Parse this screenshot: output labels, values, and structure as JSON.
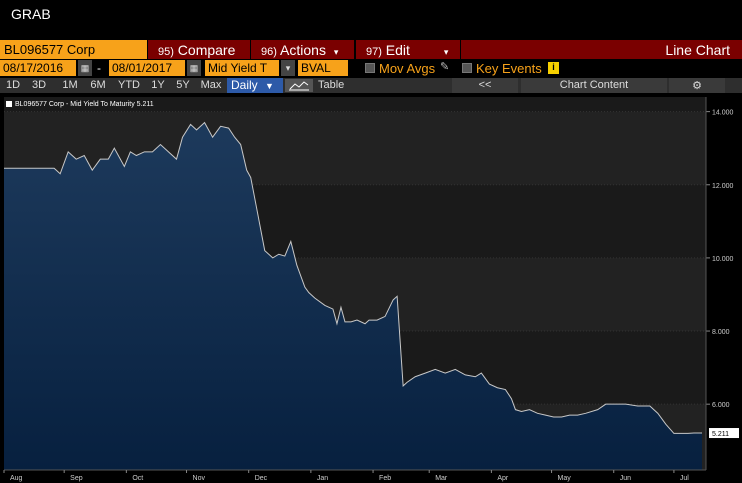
{
  "window": {
    "title": "GRAB"
  },
  "toolbar": {
    "security": "BL096577 Corp",
    "compare": {
      "num": "95)",
      "label": "Compare"
    },
    "actions": {
      "num": "96)",
      "label": "Actions"
    },
    "edit": {
      "num": "97)",
      "label": "Edit"
    },
    "chart_type": "Line Chart"
  },
  "settings": {
    "start_date": "08/17/2016",
    "end_date": "08/01/2017",
    "field": "Mid Yield T",
    "source": "BVAL",
    "mov_avgs": "Mov Avgs",
    "key_events": "Key Events",
    "info": "i"
  },
  "periods": [
    "1D",
    "3D",
    "1M",
    "6M",
    "YTD",
    "1Y",
    "5Y",
    "Max"
  ],
  "frequency": "Daily",
  "table_label": "Table",
  "collapse_label": "<<",
  "chart_content_label": "Chart Content",
  "gear": "⚙",
  "colors": {
    "accent": "#f7a21a",
    "toolbar_red": "#7a0000",
    "fill": "#0b2340",
    "line": "#c8c8c8"
  },
  "chart_data": {
    "type": "area",
    "legend": "BL096577 Corp - Mid Yield To Maturity 5.211",
    "last_value_label": "5.211",
    "ylim": [
      4.2,
      14.4
    ],
    "yticks": [
      "14.000",
      "12.000",
      "10.000",
      "8.000",
      "6.000"
    ],
    "ytick_values": [
      14,
      12,
      10,
      8,
      6
    ],
    "xticks": [
      "Aug",
      "Sep",
      "Oct",
      "Nov",
      "Dec",
      "Jan",
      "Feb",
      "Mar",
      "Apr",
      "May",
      "Jun",
      "Jul"
    ],
    "xtick_days": [
      0,
      30,
      61,
      91,
      122,
      153,
      184,
      212,
      243,
      273,
      304,
      334
    ],
    "x_days": [
      0,
      10,
      20,
      25,
      28,
      32,
      36,
      40,
      44,
      48,
      52,
      55,
      60,
      63,
      66,
      70,
      74,
      78,
      82,
      86,
      89,
      93,
      96,
      100,
      104,
      108,
      112,
      115,
      118,
      121,
      123,
      126,
      130,
      134,
      137,
      140,
      143,
      146,
      150,
      152,
      155,
      160,
      164,
      166,
      168,
      170,
      173,
      176,
      180,
      182,
      186,
      190,
      194,
      196,
      199,
      201,
      205,
      210,
      215,
      220,
      225,
      230,
      235,
      238,
      242,
      246,
      250,
      253,
      255,
      258,
      262,
      266,
      270,
      274,
      278,
      282,
      286,
      290,
      296,
      300,
      305,
      310,
      316,
      322,
      326,
      330,
      334,
      338,
      341,
      344,
      348
    ],
    "y_values": [
      12.45,
      12.45,
      12.45,
      12.45,
      12.3,
      12.9,
      12.7,
      12.8,
      12.4,
      12.7,
      12.7,
      13.0,
      12.5,
      12.9,
      12.8,
      12.9,
      12.9,
      13.1,
      12.9,
      12.7,
      13.3,
      13.65,
      13.5,
      13.7,
      13.3,
      13.6,
      13.55,
      13.3,
      13.1,
      12.4,
      12.2,
      11.35,
      10.2,
      10.0,
      10.1,
      10.05,
      10.45,
      9.8,
      9.2,
      9.05,
      8.9,
      8.7,
      8.6,
      8.2,
      8.65,
      8.25,
      8.25,
      8.3,
      8.2,
      8.3,
      8.3,
      8.4,
      8.85,
      8.95,
      6.5,
      6.6,
      6.75,
      6.85,
      6.95,
      6.85,
      6.95,
      6.8,
      6.75,
      6.85,
      6.55,
      6.45,
      6.4,
      6.15,
      5.85,
      5.8,
      5.85,
      5.75,
      5.7,
      5.65,
      5.65,
      5.7,
      5.7,
      5.75,
      5.85,
      6.0,
      6.0,
      6.0,
      5.95,
      5.95,
      5.75,
      5.45,
      5.2,
      5.2,
      5.2,
      5.211,
      5.211
    ]
  }
}
